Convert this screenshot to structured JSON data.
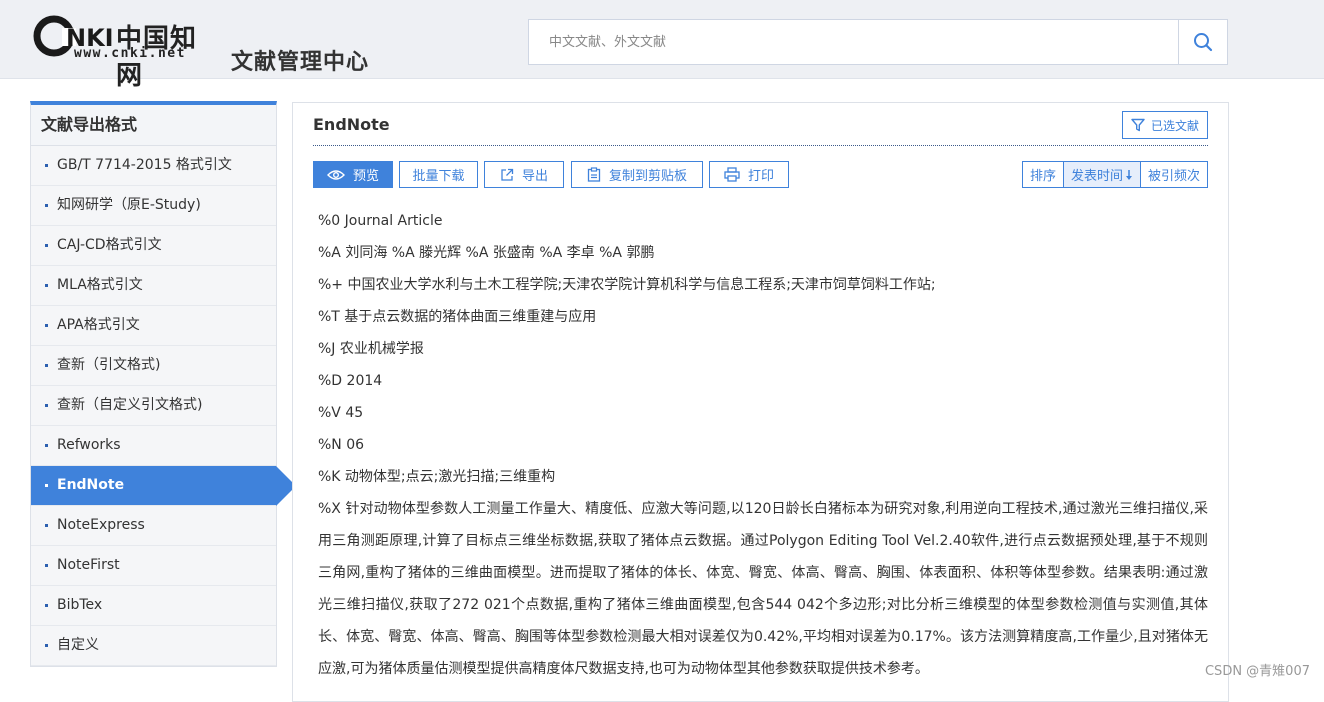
{
  "header": {
    "logo_text": "中国知网",
    "logo_url": "www.cnki.net",
    "app_title": "文献管理中心",
    "search_placeholder": "中文文献、外文文献"
  },
  "sidebar": {
    "title": "文献导出格式",
    "items": [
      {
        "label": "GB/T 7714-2015 格式引文"
      },
      {
        "label": "知网研学（原E-Study)"
      },
      {
        "label": "CAJ-CD格式引文"
      },
      {
        "label": "MLA格式引文"
      },
      {
        "label": "APA格式引文"
      },
      {
        "label": "查新（引文格式)"
      },
      {
        "label": "查新（自定义引文格式)"
      },
      {
        "label": "Refworks"
      },
      {
        "label": "EndNote",
        "active": true
      },
      {
        "label": "NoteExpress"
      },
      {
        "label": "NoteFirst"
      },
      {
        "label": "BibTex"
      },
      {
        "label": "自定义"
      }
    ]
  },
  "main": {
    "title": "EndNote",
    "selected_button": "已选文献",
    "toolbar": {
      "preview": "预览",
      "batch_download": "批量下载",
      "export": "导出",
      "copy": "复制到剪贴板",
      "print": "打印"
    },
    "sort": {
      "label": "排序",
      "by_date": "发表时间",
      "by_citations": "被引频次"
    },
    "record": {
      "line0": "%0 Journal Article",
      "line_a": "%A 刘同海 %A 滕光辉 %A 张盛南 %A 李卓 %A 郭鹏",
      "line_plus": "%+ 中国农业大学水利与土木工程学院;天津农学院计算机科学与信息工程系;天津市饲草饲料工作站;",
      "line_t": "%T 基于点云数据的猪体曲面三维重建与应用",
      "line_j": "%J 农业机械学报",
      "line_d": "%D 2014",
      "line_v": "%V 45",
      "line_n": "%N 06",
      "line_k": "%K 动物体型;点云;激光扫描;三维重构",
      "line_x": "%X 针对动物体型参数人工测量工作量大、精度低、应激大等问题,以120日龄长白猪标本为研究对象,利用逆向工程技术,通过激光三维扫描仪,采用三角测距原理,计算了目标点三维坐标数据,获取了猪体点云数据。通过Polygon Editing Tool Vel.2.40软件,进行点云数据预处理,基于不规则三角网,重构了猪体的三维曲面模型。进而提取了猪体的体长、体宽、臀宽、体高、臀高、胸围、体表面积、体积等体型参数。结果表明:通过激光三维扫描仪,获取了272 021个点数据,重构了猪体三维曲面模型,包含544 042个多边形;对比分析三维模型的体型参数检测值与实测值,其体长、体宽、臀宽、体高、臀高、胸围等体型参数检测最大相对误差仅为0.42%,平均相对误差为0.17%。该方法测算精度高,工作量少,且对猪体无应激,可为猪体质量估测模型提供高精度体尺数据支持,也可为动物体型其他参数获取提供技术参考。"
    }
  },
  "watermark": "CSDN @青雉007",
  "colors": {
    "accent": "#3f82db",
    "header_bg": "#eef0f4"
  }
}
